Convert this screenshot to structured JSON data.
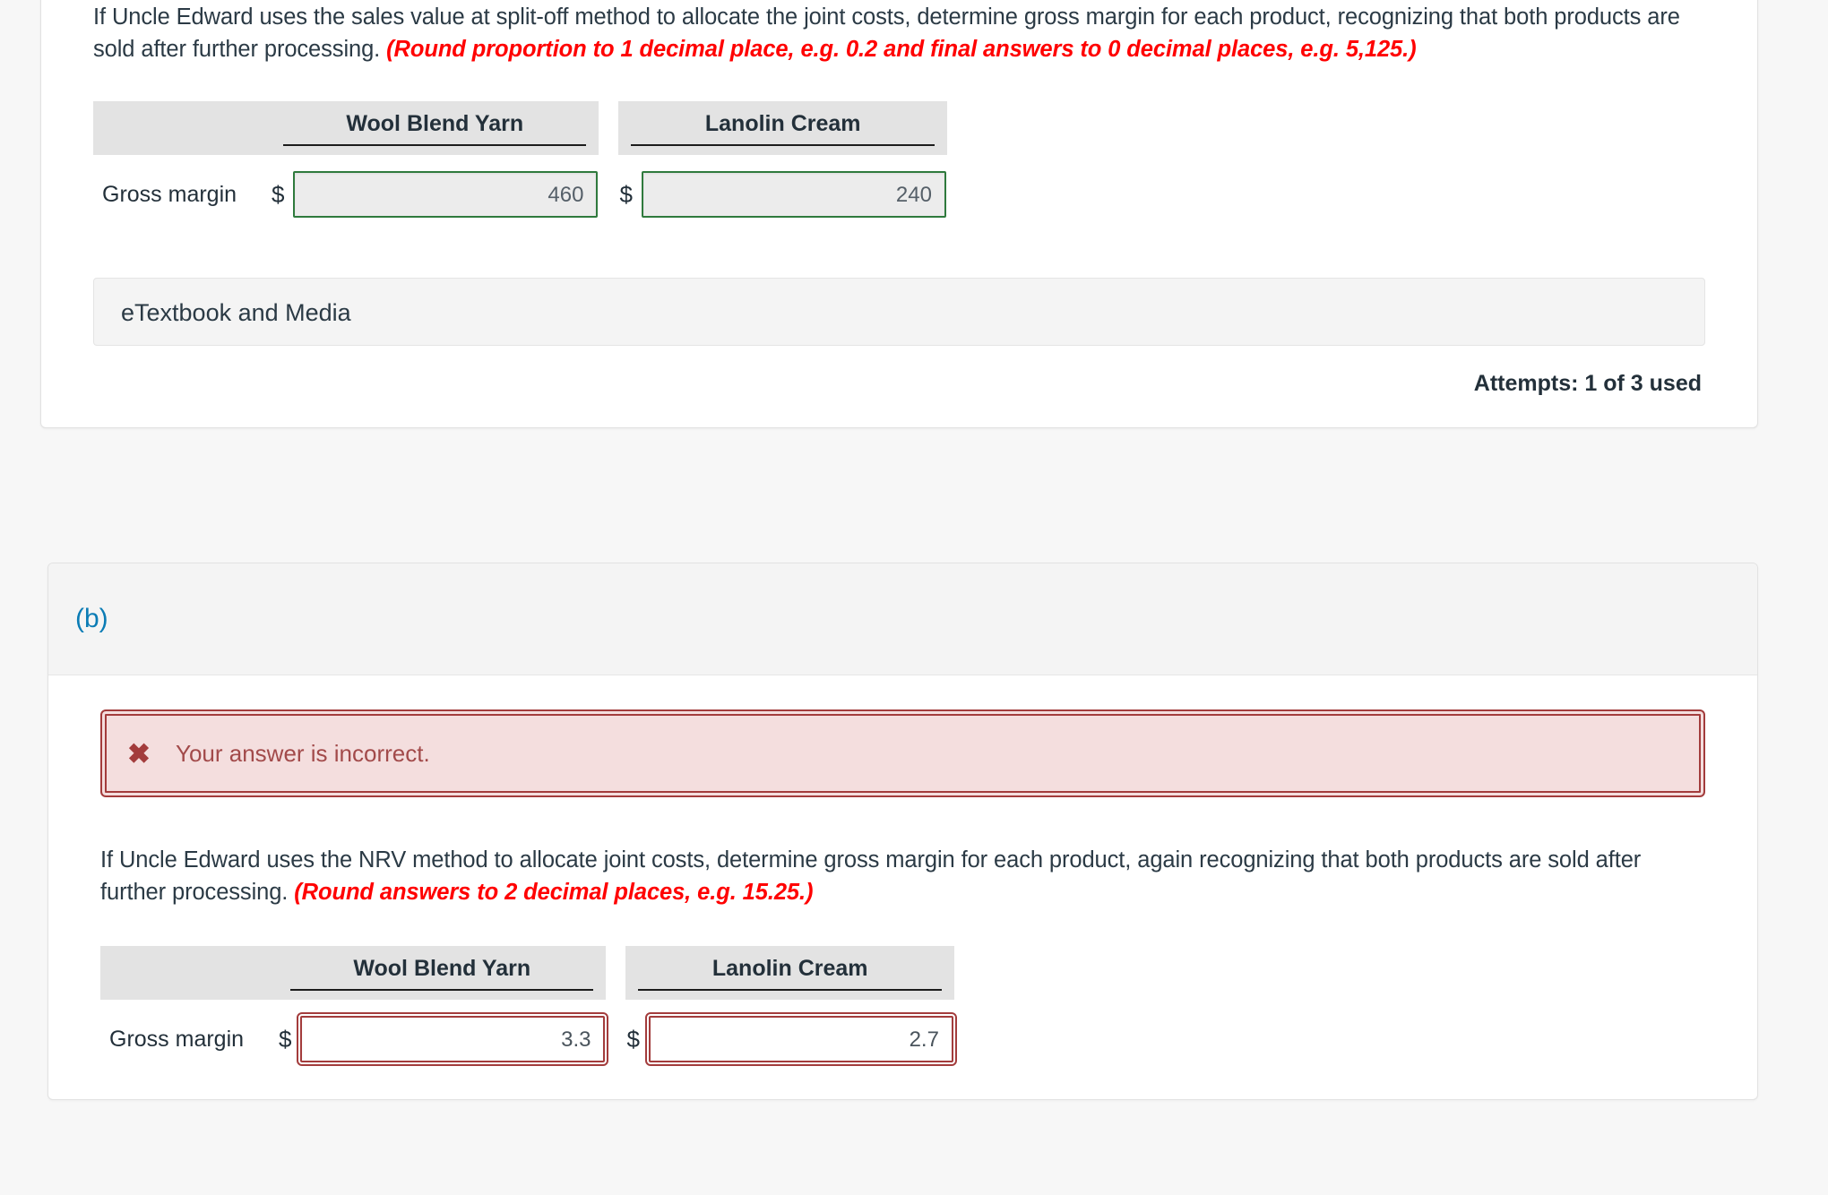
{
  "part_a": {
    "question_text_plain": "If Uncle Edward uses the sales value at split-off method to allocate the joint costs, determine gross margin for each product, recognizing that both products are sold after further processing. ",
    "question_hint": "(Round proportion to 1 decimal place, e.g. 0.2 and final answers to 0 decimal places, e.g. 5,125.)",
    "table": {
      "row_label": "Gross margin",
      "currency_symbol": "$",
      "columns": [
        "Wool Blend Yarn",
        "Lanolin Cream"
      ],
      "values": [
        "460",
        "240"
      ]
    },
    "etextbook_label": "eTextbook and Media",
    "attempts_text": "Attempts: 1 of 3 used"
  },
  "part_b": {
    "part_label": "(b)",
    "alert": {
      "icon": "x-mark-icon",
      "message": "Your answer is incorrect."
    },
    "question_text_plain": "If Uncle Edward uses the NRV method to allocate joint costs, determine gross margin for each product, again recognizing that both products are sold after further processing. ",
    "question_hint": "(Round answers to 2 decimal places, e.g. 15.25.)",
    "table": {
      "row_label": "Gross margin",
      "currency_symbol": "$",
      "columns": [
        "Wool Blend Yarn",
        "Lanolin Cream"
      ],
      "values": [
        "3.3",
        "2.7"
      ]
    }
  },
  "colors": {
    "hint_red": "#ff0000",
    "correct_green": "#2f7a3d",
    "error_red": "#a33c3c",
    "part_blue": "#0b7cb5",
    "header_gray": "#e3e3e3"
  }
}
